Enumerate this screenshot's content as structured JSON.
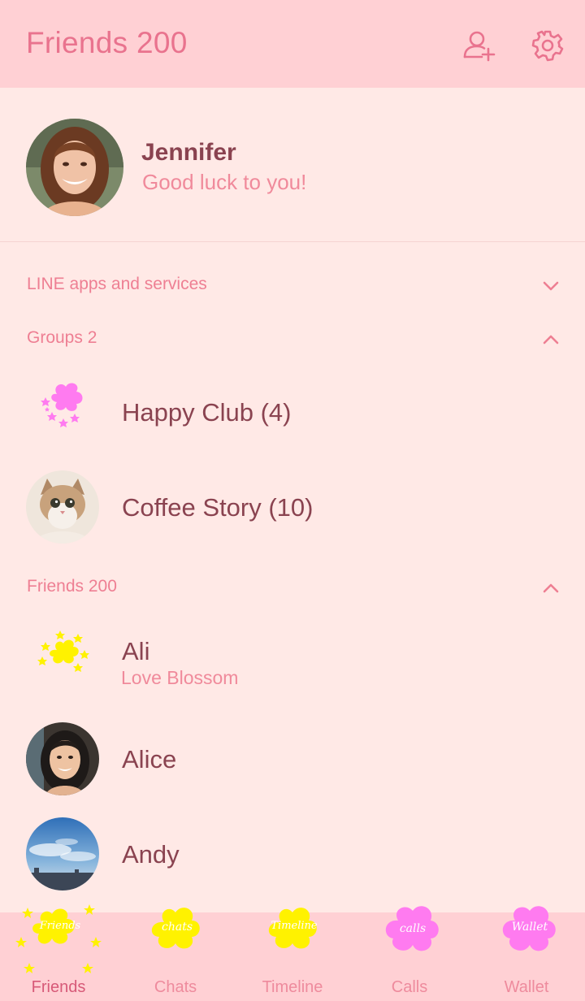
{
  "header": {
    "title": "Friends 200",
    "add_friend_icon": "add-friend-icon",
    "settings_icon": "gear-icon"
  },
  "profile": {
    "name": "Jennifer",
    "status": "Good luck to you!"
  },
  "sections": {
    "line_apps": {
      "label": "LINE apps and services",
      "state": "collapsed"
    },
    "groups": {
      "label": "Groups 2",
      "state": "expanded"
    },
    "friends": {
      "label": "Friends 200",
      "state": "expanded"
    }
  },
  "groups": [
    {
      "name": "Happy Club (4)",
      "icon": "pink-flower-icon"
    },
    {
      "name": "Coffee Story (10)",
      "icon": "cat-avatar"
    }
  ],
  "friends": [
    {
      "name": "Ali",
      "status": "Love Blossom",
      "icon": "yellow-flower-icon"
    },
    {
      "name": "Alice",
      "icon": "avatar"
    },
    {
      "name": "Andy",
      "icon": "sky-avatar"
    }
  ],
  "tabs": [
    {
      "label": "Friends",
      "icon_text": "Friends",
      "active": true
    },
    {
      "label": "Chats",
      "icon_text": "chats",
      "active": false
    },
    {
      "label": "Timeline",
      "icon_text": "Timeline",
      "active": false
    },
    {
      "label": "Calls",
      "icon_text": "calls",
      "active": false
    },
    {
      "label": "Wallet",
      "icon_text": "Wallet",
      "active": false
    }
  ],
  "colors": {
    "header_bg": "#ffd0d4",
    "page_bg": "#ffe9e6",
    "accent_pink": "#e9738e",
    "name_text": "#8a4350",
    "yellow": "#fff200",
    "magenta": "#ff7bf0"
  }
}
